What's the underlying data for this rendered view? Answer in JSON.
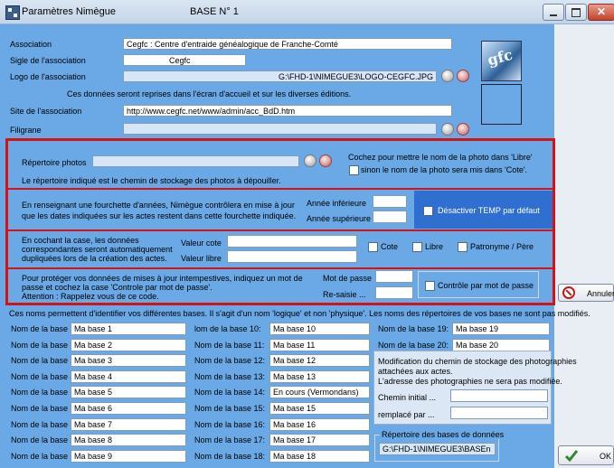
{
  "window": {
    "title": "Paramètres Nimègue",
    "base_label": "BASE N° 1"
  },
  "association": {
    "assoc_label": "Association",
    "assoc_value": "Cegfc : Centre d'entraide généalogique de Franche-Comté",
    "sigle_label": "Sigle de l'association",
    "sigle_value": "Cegfc",
    "logo_label": "Logo de l'association",
    "logo_value": "G:\\FHD-1\\NIMEGUE3\\LOGO-CEGFC.JPG",
    "info_text": "Ces données seront reprises dans l'écran d'accueil et sur les diverses éditions.",
    "site_label": "Site de l'association",
    "site_value": "http://www.cegfc.net/www/admin/acc_BdD.htm",
    "filigrane_label": "Filigrane"
  },
  "photos": {
    "rep_label": "Répertoire photos",
    "cb_text_1": "Cochez pour mettre le nom de la photo dans 'Libre'",
    "cb_text_2": "sinon le nom de la photo sera mis dans 'Cote'.",
    "desc": "Le répertoire indiqué est le chemin de stockage des photos à dépouiller."
  },
  "years": {
    "desc_1": "En renseignant une fourchette d'années, Nimègue contrôlera en mise à jour",
    "desc_2": "que les dates indiquées sur les actes restent dans cette fourchette indiquée.",
    "inf_label": "Année inférieure",
    "sup_label": "Année supérieure",
    "temp_label": "Désactiver TEMP par défaut"
  },
  "dup": {
    "desc_1": "En cochant la case, les données",
    "desc_2": "correspondantes seront automatiquement",
    "desc_3": "dupliquées lors de la création des actes.",
    "cote_label": "Valeur cote",
    "libre_label": "Valeur libre",
    "cb_cote": "Cote",
    "cb_libre": "Libre",
    "cb_patronyme": "Patronyme / Père"
  },
  "password": {
    "desc_1": "Pour protéger vos données de mises à jour intempestives, indiquez un mot de",
    "desc_2": "passe et cochez la case 'Controle par mot de passe'.",
    "desc_3": "Attention : Rappelez vous de ce code.",
    "pw_label": "Mot de passe",
    "repw_label": "Re-saisie ...",
    "ctrl_label": "Contrôle par mot de passe"
  },
  "bases": {
    "note": "Ces noms permettent d'identifier vos différentes bases. Il s'agit d'un nom 'logique' et non 'physique'. Les noms des répertoires de vos bases ne sont pas modifiés.",
    "col1": [
      {
        "label": "Nom de la base 1:",
        "value": "Ma base 1"
      },
      {
        "label": "Nom de la base 2:",
        "value": "Ma base  2"
      },
      {
        "label": "Nom de la base 3:",
        "value": "Ma base  3"
      },
      {
        "label": "Nom de la base 4:",
        "value": "Ma base  4"
      },
      {
        "label": "Nom de la base 5:",
        "value": "Ma base  5"
      },
      {
        "label": "Nom de la base 6:",
        "value": "Ma base  6"
      },
      {
        "label": "Nom de la base 7:",
        "value": "Ma base  7"
      },
      {
        "label": "Nom de la base 8:",
        "value": "Ma base  8"
      },
      {
        "label": "Nom de la base 9:",
        "value": "Ma base  9"
      }
    ],
    "col2": [
      {
        "label": "lom de la base 10:",
        "value": "Ma base 10"
      },
      {
        "label": "Nom de la base 11:",
        "value": "Ma base 11"
      },
      {
        "label": "Nom de la base 12:",
        "value": "Ma base 12"
      },
      {
        "label": "Nom de la base 13:",
        "value": "Ma base 13"
      },
      {
        "label": "Nom de la base 14:",
        "value": "En cours (Vermondans)"
      },
      {
        "label": "Nom de la base 15:",
        "value": "Ma base 15"
      },
      {
        "label": "Nom de la base 16:",
        "value": "Ma base 16"
      },
      {
        "label": "Nom de la base 17:",
        "value": "Ma base 17"
      },
      {
        "label": "Nom de la base 18:",
        "value": "Ma base 18"
      }
    ],
    "col3": [
      {
        "label": "Nom de la base 19:",
        "value": "Ma base 19"
      },
      {
        "label": "Nom de la base 20:",
        "value": "Ma base 20"
      }
    ]
  },
  "photo_path": {
    "desc_1": "Modification du chemin de stockage des photographies",
    "desc_2": "attachées aux actes.",
    "desc_3": "L'adresse des photographies ne sera pas modifiée.",
    "initial_label": "Chemin initial ...",
    "replaced_label": "remplacé par ..."
  },
  "db_dir": {
    "label": "Répertoire des bases de données",
    "value": "G:\\FHD-1\\NIMEGUE3\\BASEn"
  },
  "buttons": {
    "cancel": "Annuler",
    "ok": "OK"
  }
}
